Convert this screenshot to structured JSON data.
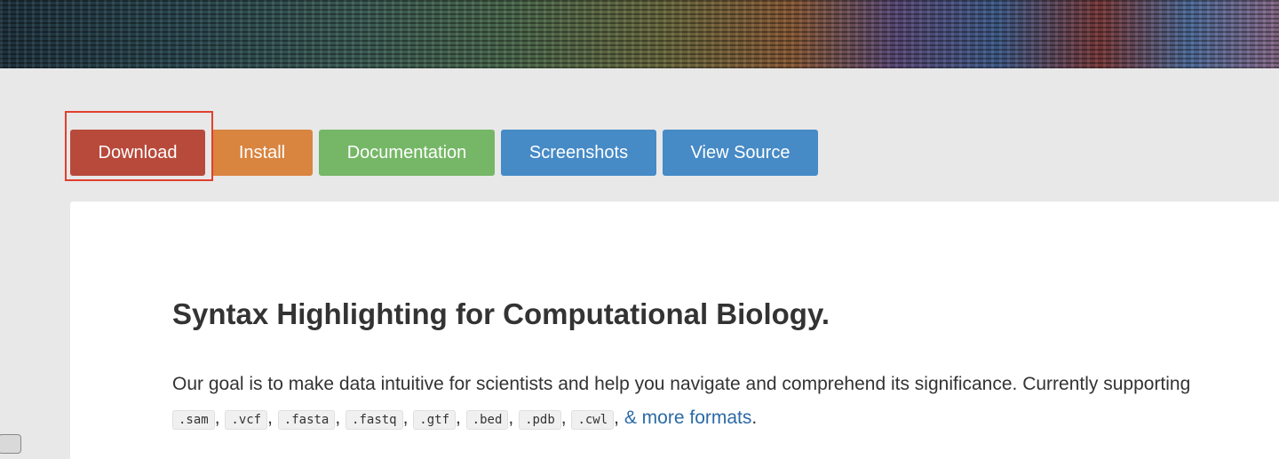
{
  "nav": {
    "download": "Download",
    "install": "Install",
    "documentation": "Documentation",
    "screenshots": "Screenshots",
    "view_source": "View Source"
  },
  "main": {
    "title": "Syntax Highlighting for Computational Biology.",
    "intro": "Our goal is to make data intuitive for scientists and help you navigate and comprehend its significance. Currently supporting",
    "formats": [
      ".sam",
      ".vcf",
      ".fasta",
      ".fastq",
      ".gtf",
      ".bed",
      ".pdb",
      ".cwl"
    ],
    "more_link": "& more formats"
  },
  "colors": {
    "download": "#b84a3b",
    "install": "#d9843f",
    "documentation": "#75b766",
    "screenshots": "#468ac6",
    "view_source": "#468ac6",
    "highlight": "#e0402e"
  }
}
